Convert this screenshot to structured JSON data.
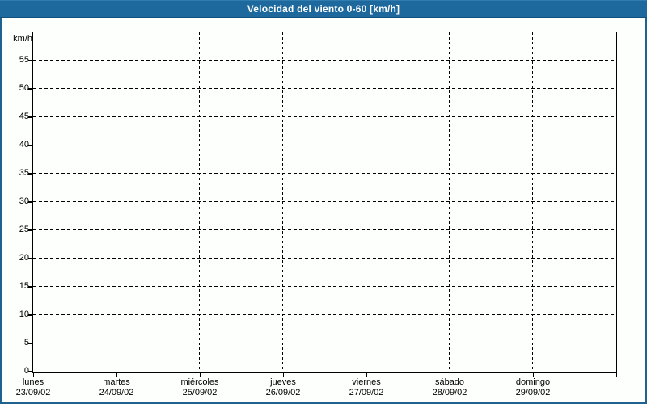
{
  "window": {
    "title": "Velocidad del viento 0-60 [km/h]"
  },
  "colors": {
    "titlebar_bg": "#1d699d",
    "titlebar_text": "#ffffff",
    "frame_border": "#1f6290",
    "background": "#fdfffd",
    "axis_and_grid": "#000000"
  },
  "chart_data": {
    "type": "line",
    "title": "Velocidad del viento 0-60 [km/h]",
    "ylabel": "km/h",
    "ylim": [
      0,
      60
    ],
    "y_ticks": [
      0,
      5,
      10,
      15,
      20,
      25,
      30,
      35,
      40,
      45,
      50,
      55
    ],
    "x_categories": [
      {
        "day": "lunes",
        "date": "23/09/02"
      },
      {
        "day": "martes",
        "date": "24/09/02"
      },
      {
        "day": "miércoles",
        "date": "25/09/02"
      },
      {
        "day": "jueves",
        "date": "26/09/02"
      },
      {
        "day": "viernes",
        "date": "27/09/02"
      },
      {
        "day": "sábado",
        "date": "28/09/02"
      },
      {
        "day": "domingo",
        "date": "29/09/02"
      }
    ],
    "series": [],
    "grid": "dashed",
    "legend": "none"
  }
}
